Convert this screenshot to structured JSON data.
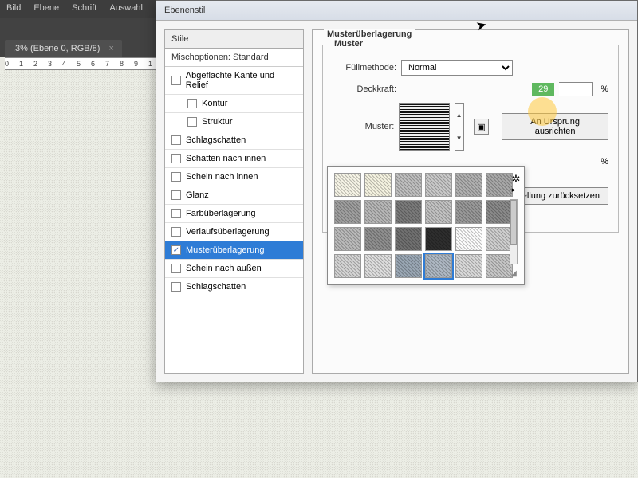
{
  "menu": {
    "items": [
      "Bild",
      "Ebene",
      "Schrift",
      "Auswahl"
    ]
  },
  "doc_tab": {
    "label": ",3% (Ebene 0, RGB/8)",
    "close": "×"
  },
  "ruler": {
    "marks": [
      "0",
      "1",
      "2",
      "3",
      "4",
      "5",
      "6",
      "7",
      "8",
      "9",
      "1"
    ]
  },
  "dialog": {
    "title": "Ebenenstil",
    "styles_header": "Stile",
    "blend_row": "Mischoptionen: Standard",
    "styles": [
      {
        "label": "Abgeflachte Kante und Relief",
        "checked": false
      },
      {
        "label": "Kontur",
        "checked": false,
        "indent": true
      },
      {
        "label": "Struktur",
        "checked": false,
        "indent": true
      },
      {
        "label": "Schlagschatten",
        "checked": false
      },
      {
        "label": "Schatten nach innen",
        "checked": false
      },
      {
        "label": "Schein nach innen",
        "checked": false
      },
      {
        "label": "Glanz",
        "checked": false
      },
      {
        "label": "Farbüberlagerung",
        "checked": false
      },
      {
        "label": "Verlaufsüberlagerung",
        "checked": false
      },
      {
        "label": "Musterüberlagerung",
        "checked": true,
        "sel": true
      },
      {
        "label": "Schein nach außen",
        "checked": false
      },
      {
        "label": "Schlagschatten",
        "checked": false
      }
    ],
    "panel": {
      "title": "Musterüberlagerung",
      "subtitle": "Muster",
      "fill_label": "Füllmethode:",
      "fill_value": "Normal",
      "opacity_label": "Deckkraft:",
      "opacity_value": "29",
      "opacity_unit": "%",
      "pattern_label": "Muster:",
      "snap_btn": "An Ursprung ausrichten",
      "extra_percent": "%",
      "reset_btn": "einstellung zurücksetzen"
    },
    "picker": {
      "row_count": 4,
      "col_count": 6,
      "selected_index": 21
    }
  }
}
